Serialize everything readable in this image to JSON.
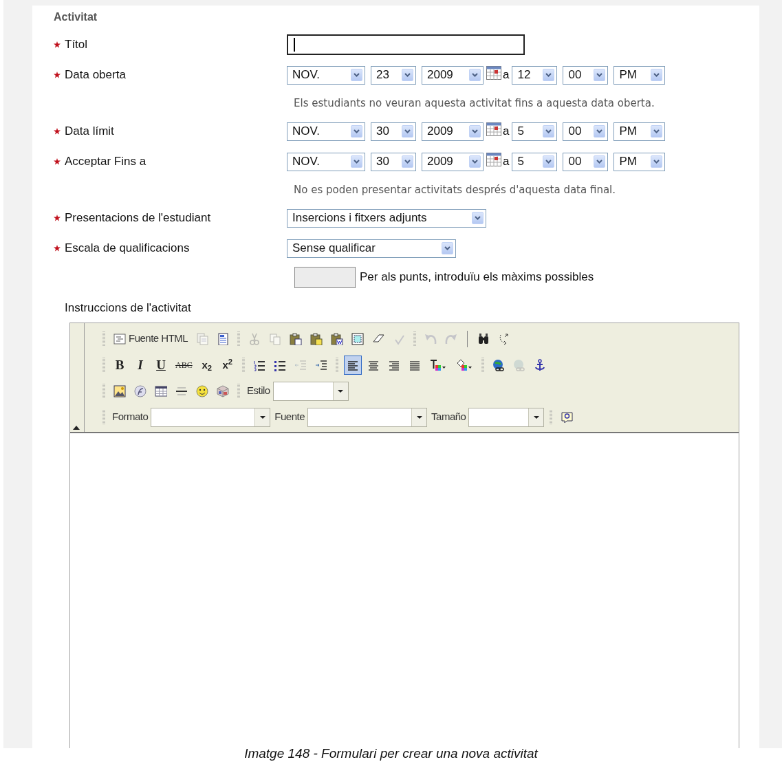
{
  "section_title": "Activitat",
  "fields": [
    {
      "kind": "text",
      "required": true,
      "label": "Títol",
      "focused": true
    },
    {
      "kind": "datetime",
      "required": true,
      "label": "Data oberta",
      "month": "NOV.",
      "day": "23",
      "year": "2009",
      "at": "a",
      "hour": "12",
      "minute": "00",
      "ampm": "PM",
      "hint": "Els estudiants no veuran aquesta activitat fins a aquesta data oberta."
    },
    {
      "kind": "datetime",
      "required": true,
      "label": "Data límit",
      "month": "NOV.",
      "day": "30",
      "year": "2009",
      "at": "a",
      "hour": "5",
      "minute": "00",
      "ampm": "PM"
    },
    {
      "kind": "datetime",
      "required": true,
      "label": "Acceptar Fins a",
      "month": "NOV.",
      "day": "30",
      "year": "2009",
      "at": "a",
      "hour": "5",
      "minute": "00",
      "ampm": "PM",
      "hint": "No es poden presentar activitats després d'aquesta data final."
    },
    {
      "kind": "select",
      "required": true,
      "label": "Presentacions de l'estudiant",
      "value": "Insercions i fitxers adjunts"
    },
    {
      "kind": "select",
      "required": true,
      "label": "Escala de qualificacions",
      "value": "Sense qualificar",
      "points_note": "Per als punts, introduïu els màxims possibles"
    }
  ],
  "instructions_label": "Instruccions de l'activitat",
  "editor": {
    "toolbar_rows": [
      [
        {
          "kind": "grip"
        },
        {
          "kind": "source",
          "label": "Fuente HTML",
          "disabled": false
        },
        {
          "kind": "preview",
          "disabled": true
        },
        {
          "kind": "templates",
          "disabled": false
        },
        {
          "kind": "grip"
        },
        {
          "kind": "cut",
          "disabled": true
        },
        {
          "kind": "copy",
          "disabled": true
        },
        {
          "kind": "paste",
          "disabled": false
        },
        {
          "kind": "pastetext",
          "disabled": false
        },
        {
          "kind": "pasteword",
          "disabled": false
        },
        {
          "kind": "selectall",
          "disabled": false
        },
        {
          "kind": "eraser",
          "disabled": false
        },
        {
          "kind": "spell",
          "disabled": true
        },
        {
          "kind": "grip"
        },
        {
          "kind": "undo",
          "disabled": true
        },
        {
          "kind": "redo",
          "disabled": true
        },
        {
          "kind": "bar"
        },
        {
          "kind": "find",
          "disabled": false
        },
        {
          "kind": "replace",
          "disabled": false
        }
      ],
      [
        {
          "kind": "grip"
        },
        {
          "kind": "bold",
          "glyph": "B"
        },
        {
          "kind": "italic",
          "glyph": "I"
        },
        {
          "kind": "underline",
          "glyph": "U"
        },
        {
          "kind": "strike",
          "glyph": "ABC"
        },
        {
          "kind": "glyph",
          "glyph": "x$_{2}$"
        },
        {
          "kind": "glyph",
          "glyph": "x$^{2}$"
        },
        {
          "kind": "grip"
        },
        {
          "kind": "ol",
          "disabled": false
        },
        {
          "kind": "ul",
          "disabled": false
        },
        {
          "kind": "outdent",
          "disabled": true
        },
        {
          "kind": "indent",
          "disabled": false
        },
        {
          "kind": "grip"
        },
        {
          "kind": "alignleft",
          "selected": true
        },
        {
          "kind": "aligncenter",
          "selected": false
        },
        {
          "kind": "alignright",
          "selected": false
        },
        {
          "kind": "justify",
          "selected": false
        },
        {
          "kind": "textcolor",
          "disabled": false
        },
        {
          "kind": "bgcolor",
          "disabled": false
        },
        {
          "kind": "grip"
        },
        {
          "kind": "link",
          "disabled": false
        },
        {
          "kind": "unlink",
          "disabled": true
        },
        {
          "kind": "anchor",
          "disabled": false
        }
      ],
      [
        {
          "kind": "grip"
        },
        {
          "kind": "image",
          "disabled": false
        },
        {
          "kind": "flash",
          "disabled": false
        },
        {
          "kind": "table",
          "disabled": false
        },
        {
          "kind": "rule",
          "disabled": false
        },
        {
          "kind": "smiley",
          "disabled": false
        },
        {
          "kind": "special",
          "disabled": false
        },
        {
          "kind": "grip"
        },
        {
          "kind": "combo",
          "label": "Estilo",
          "wide": false
        }
      ],
      [
        {
          "kind": "grip"
        },
        {
          "kind": "combo",
          "label": "Formato",
          "wide": true
        },
        {
          "kind": "combo",
          "label": "Fuente",
          "wide": true
        },
        {
          "kind": "combo",
          "label": "Tamaño",
          "wide": false
        },
        {
          "kind": "grip"
        },
        {
          "kind": "help",
          "disabled": false
        }
      ]
    ]
  },
  "caption": "Imatge 148 - Formulari per crear una nova activitat"
}
